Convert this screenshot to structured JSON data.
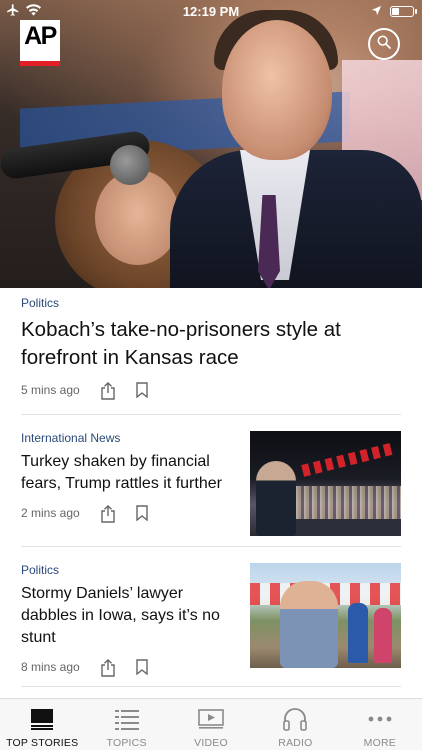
{
  "status_bar": {
    "time": "12:19 PM"
  },
  "header": {
    "logo_text": "AP",
    "logo_accent_color": "#e21f26"
  },
  "lead_story": {
    "category": "Politics",
    "headline": "Kobach’s take-no-prisoners style at forefront in Kansas race",
    "time": "5 mins ago"
  },
  "stories": [
    {
      "category": "International News",
      "headline": "Turkey shaken by financial fears, Trump rattles it further",
      "time": "2 mins ago"
    },
    {
      "category": "Politics",
      "headline": "Stormy Daniels’ lawyer dabbles in Iowa, says it’s no stunt",
      "time": "8 mins ago"
    }
  ],
  "tabs": [
    {
      "label": "TOP STORIES",
      "icon": "top-stories-icon",
      "active": true
    },
    {
      "label": "TOPICS",
      "icon": "list-icon",
      "active": false
    },
    {
      "label": "VIDEO",
      "icon": "video-icon",
      "active": false
    },
    {
      "label": "RADIO",
      "icon": "headphones-icon",
      "active": false
    },
    {
      "label": "MORE",
      "icon": "more-icon",
      "active": false
    }
  ],
  "colors": {
    "category": "#2a4a7a",
    "accent": "#e21f26"
  }
}
